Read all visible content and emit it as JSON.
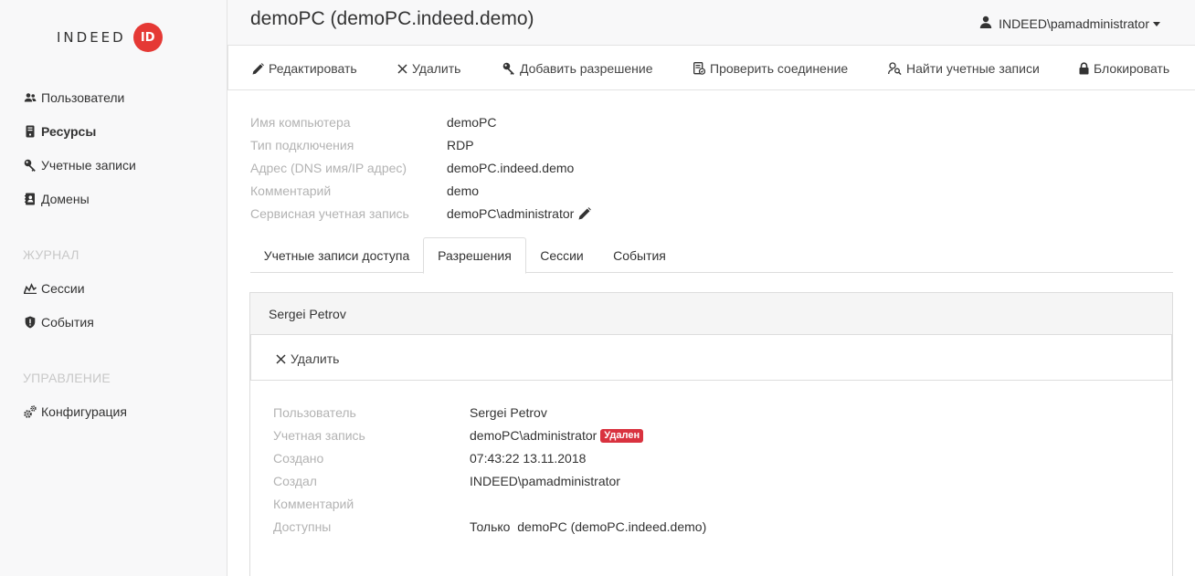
{
  "logo": {
    "text": "INDEED",
    "badge": "ID"
  },
  "sidebar": {
    "items": [
      {
        "label": "Пользователи",
        "icon": "users-icon"
      },
      {
        "label": "Ресурсы",
        "icon": "server-icon",
        "active": true
      },
      {
        "label": "Учетные записи",
        "icon": "key-icon"
      },
      {
        "label": "Домены",
        "icon": "address-book-icon"
      }
    ],
    "section_journal": "ЖУРНАЛ",
    "journal_items": [
      {
        "label": "Сессии",
        "icon": "sessions-icon"
      },
      {
        "label": "События",
        "icon": "shield-icon"
      }
    ],
    "section_manage": "УПРАВЛЕНИЕ",
    "manage_items": [
      {
        "label": "Конфигурация",
        "icon": "cogs-icon"
      }
    ]
  },
  "header": {
    "title": "demoPC (demoPC.indeed.demo)",
    "user": "INDEED\\pamadministrator"
  },
  "toolbar": {
    "edit": "Редактировать",
    "delete": "Удалить",
    "add_permission": "Добавить разрешение",
    "check_connection": "Проверить соединение",
    "find_accounts": "Найти учетные записи",
    "block": "Блокировать"
  },
  "details": {
    "computer_name_label": "Имя компьютера",
    "computer_name": "demoPC",
    "connection_type_label": "Тип подключения",
    "connection_type": "RDP",
    "address_label": "Адрес (DNS имя/IP адрес)",
    "address": "demoPC.indeed.demo",
    "comment_label": "Комментарий",
    "comment": "demo",
    "service_account_label": "Сервисная учетная запись",
    "service_account": "demoPC\\administrator"
  },
  "tabs": [
    {
      "label": "Учетные записи доступа"
    },
    {
      "label": "Разрешения",
      "active": true
    },
    {
      "label": "Сессии"
    },
    {
      "label": "События"
    }
  ],
  "permission": {
    "title": "Sergei Petrov",
    "delete": "Удалить",
    "user_label": "Пользователь",
    "user": "Sergei Petrov",
    "account_label": "Учетная запись",
    "account": "demoPC\\administrator",
    "account_badge": "Удален",
    "created_label": "Создано",
    "created": "07:43:22 13.11.2018",
    "creator_label": "Создал",
    "creator": "INDEED\\pamadministrator",
    "comment_label": "Комментарий",
    "comment": "",
    "available_label": "Доступны",
    "available": "Только  demoPC (demoPC.indeed.demo)"
  },
  "colors": {
    "accent": "#e53935",
    "badge": "#d9323f",
    "label": "#b3b3b3"
  }
}
